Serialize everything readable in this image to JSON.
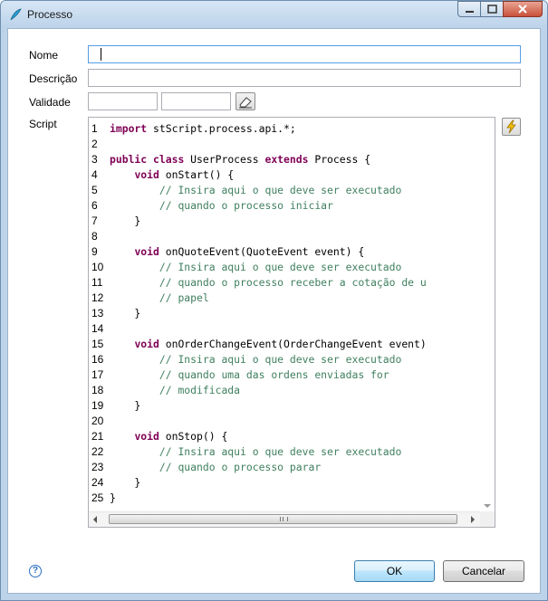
{
  "window": {
    "title": "Processo"
  },
  "form": {
    "nome_label": "Nome",
    "nome_value": "",
    "descricao_label": "Descrição",
    "descricao_value": "",
    "validade_label": "Validade",
    "validade_from": "",
    "validade_to": "",
    "script_label": "Script"
  },
  "script": {
    "lines": [
      [
        [
          "kw",
          "import"
        ],
        [
          "n",
          " stScript.process.api.*;"
        ]
      ],
      [],
      [
        [
          "kw",
          "public"
        ],
        [
          "n",
          " "
        ],
        [
          "kw",
          "class"
        ],
        [
          "n",
          " UserProcess "
        ],
        [
          "kw",
          "extends"
        ],
        [
          "n",
          " Process {"
        ]
      ],
      [
        [
          "n",
          "    "
        ],
        [
          "kw",
          "void"
        ],
        [
          "n",
          " onStart() {"
        ]
      ],
      [
        [
          "n",
          "        "
        ],
        [
          "cm",
          "// Insira aqui o que deve ser executado"
        ]
      ],
      [
        [
          "n",
          "        "
        ],
        [
          "cm",
          "// quando o processo iniciar"
        ]
      ],
      [
        [
          "n",
          "    }"
        ]
      ],
      [],
      [
        [
          "n",
          "    "
        ],
        [
          "kw",
          "void"
        ],
        [
          "n",
          " onQuoteEvent(QuoteEvent event) {"
        ]
      ],
      [
        [
          "n",
          "        "
        ],
        [
          "cm",
          "// Insira aqui o que deve ser executado"
        ]
      ],
      [
        [
          "n",
          "        "
        ],
        [
          "cm",
          "// quando o processo receber a cotação de u"
        ]
      ],
      [
        [
          "n",
          "        "
        ],
        [
          "cm",
          "// papel"
        ]
      ],
      [
        [
          "n",
          "    }"
        ]
      ],
      [],
      [
        [
          "n",
          "    "
        ],
        [
          "kw",
          "void"
        ],
        [
          "n",
          " onOrderChangeEvent(OrderChangeEvent event)"
        ]
      ],
      [
        [
          "n",
          "        "
        ],
        [
          "cm",
          "// Insira aqui o que deve ser executado"
        ]
      ],
      [
        [
          "n",
          "        "
        ],
        [
          "cm",
          "// quando uma das ordens enviadas for"
        ]
      ],
      [
        [
          "n",
          "        "
        ],
        [
          "cm",
          "// modificada"
        ]
      ],
      [
        [
          "n",
          "    }"
        ]
      ],
      [],
      [
        [
          "n",
          "    "
        ],
        [
          "kw",
          "void"
        ],
        [
          "n",
          " onStop() {"
        ]
      ],
      [
        [
          "n",
          "        "
        ],
        [
          "cm",
          "// Insira aqui o que deve ser executado"
        ]
      ],
      [
        [
          "n",
          "        "
        ],
        [
          "cm",
          "// quando o processo parar"
        ]
      ],
      [
        [
          "n",
          "    }"
        ]
      ],
      [
        [
          "n",
          "}"
        ]
      ]
    ]
  },
  "buttons": {
    "ok": "OK",
    "cancel": "Cancelar",
    "help": "?"
  },
  "icons": {
    "app": "feather-icon",
    "eraser": "eraser-icon",
    "run": "lightning-icon",
    "help": "help-icon",
    "minimize": "minimize-icon",
    "maximize": "maximize-icon",
    "close": "close-icon"
  },
  "colors": {
    "keyword": "#7f0055",
    "comment": "#3f7f5f",
    "frame": "#bcd3ea"
  }
}
